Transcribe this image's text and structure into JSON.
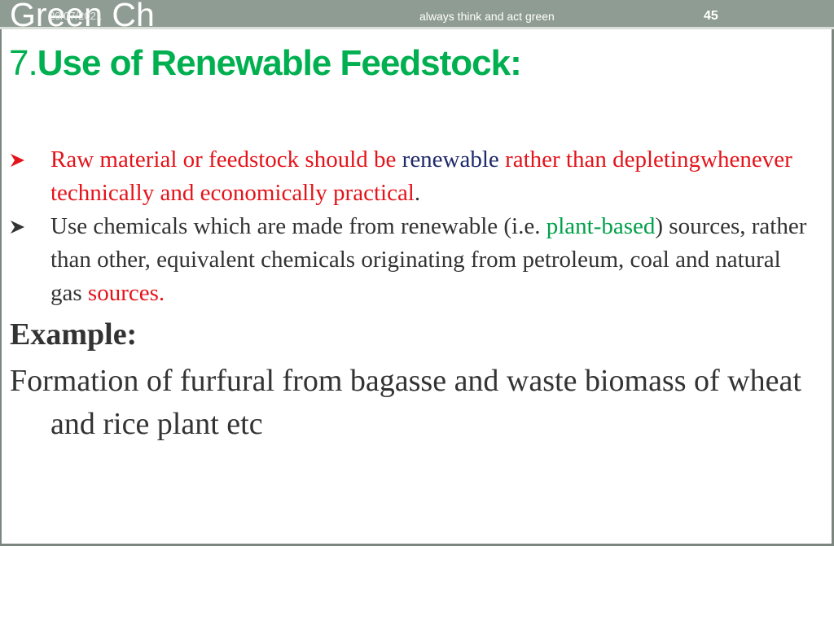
{
  "header": {
    "brand": "Green Ch",
    "date": "20/07/2021",
    "tagline": "always think and act green",
    "page_number": "45"
  },
  "slide": {
    "title_number": "7.",
    "title_text": "Use of Renewable Feedstock:",
    "bullets": [
      {
        "part1": "Raw material or feedstock should be ",
        "part2": "renewable",
        "part3": " rather than depletingwhenever technically and economically practical",
        "part4": "."
      },
      {
        "part1": "Use chemicals which are made from renewable (i.e. ",
        "part2": "plant-based",
        "part3": ") sources, rather than other, equivalent chemicals originating from petroleum, coal and natural gas ",
        "part4": "sources."
      }
    ],
    "example_label": "Example:",
    "example_text": "Formation of furfural from bagasse and waste biomass of wheat and rice plant etc"
  },
  "colors": {
    "header_bg": "#8f9c93",
    "title": "#00b050",
    "highlight_red": "#e4141b",
    "highlight_navy": "#1f2a6b",
    "highlight_green": "#00a04a",
    "body_text": "#333333"
  }
}
